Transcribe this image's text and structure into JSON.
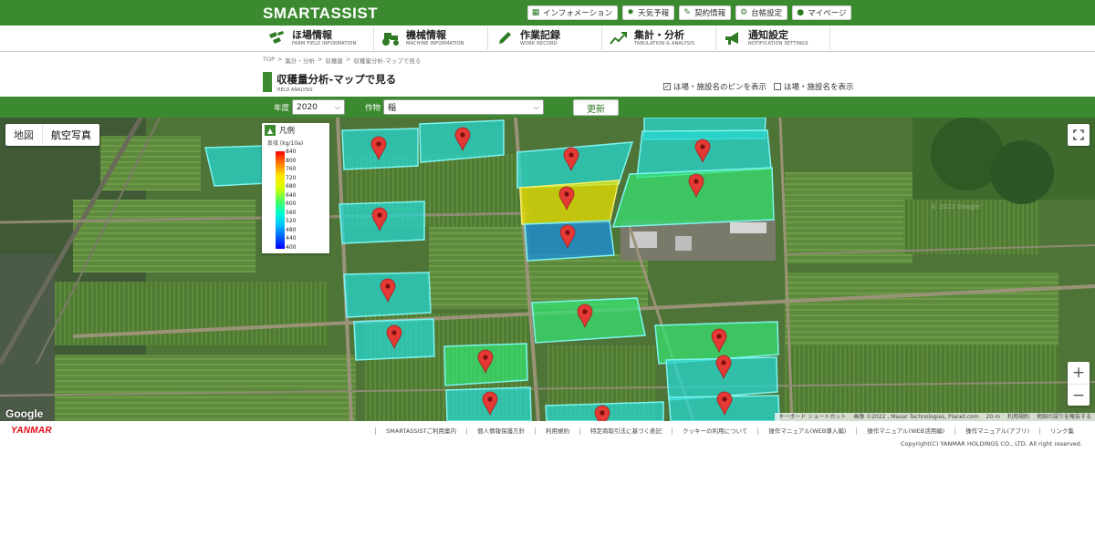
{
  "header": {
    "logo": "SMARTASSIST",
    "links": [
      {
        "icon": "info-icon",
        "label": "インフォメーション"
      },
      {
        "icon": "weather-icon",
        "label": "天気予報"
      },
      {
        "icon": "contract-icon",
        "label": "契約情報"
      },
      {
        "icon": "settings-icon",
        "label": "台帳設定"
      },
      {
        "icon": "user-icon",
        "label": "マイページ"
      }
    ]
  },
  "nav": {
    "items": [
      {
        "label": "ほ場情報",
        "sub": "FARM FIELD INFORMATION",
        "icon": "field-icon"
      },
      {
        "label": "機械情報",
        "sub": "MACHINE INFORMATION",
        "icon": "tractor-icon"
      },
      {
        "label": "作業記録",
        "sub": "WORK RECORD",
        "icon": "pencil-icon"
      },
      {
        "label": "集計・分析",
        "sub": "TABULATION & ANALYSIS",
        "icon": "chart-icon"
      },
      {
        "label": "通知設定",
        "sub": "NOTIFICATION SETTINGS",
        "icon": "megaphone-icon"
      }
    ]
  },
  "breadcrumb": [
    "TOP",
    ">",
    "集計・分析",
    ">",
    "収穫量",
    ">",
    "収穫量分析-マップで見る"
  ],
  "page": {
    "title": "収穫量分析-マップで見る",
    "subtitle": "YIELD ANALYSIS"
  },
  "options": {
    "show_pin_label": "ほ場・施設名のピンを表示",
    "show_pin_checked": true,
    "show_name_label": "ほ場・施設名を表示",
    "show_name_checked": false
  },
  "filters": {
    "year_label": "年度",
    "year_value": "2020",
    "crop_label": "作物",
    "crop_value": "稲",
    "update_label": "更新"
  },
  "map": {
    "type_map": "地図",
    "type_satellite": "航空写真",
    "google": "Google",
    "attribution": [
      "キーボード ショートカット",
      "画像 ©2022 , Maxar Technologies, Planet.com",
      "20 m",
      "利用規約",
      "地図の誤りを報告する"
    ],
    "watermark": "© 2022 Google"
  },
  "legend": {
    "title": "凡例",
    "unit": "反収 (kg/10a)",
    "ticks": [
      "840",
      "800",
      "760",
      "720",
      "680",
      "640",
      "600",
      "560",
      "520",
      "480",
      "440",
      "400"
    ]
  },
  "footer": {
    "brand": "YANMAR",
    "links": [
      "SMARTASSISTご利用案内",
      "個人情報保護方針",
      "利用規約",
      "特定商取引法に基づく表記",
      "クッキーの利用について",
      "操作マニュアル(WEB導入編)",
      "操作マニュアル(WEB活用編)",
      "操作マニュアル(アプリ)",
      "リンク集"
    ],
    "copyright": "Copyright(C) YANMAR HOLDINGS CO., LTD. All right reserved."
  }
}
